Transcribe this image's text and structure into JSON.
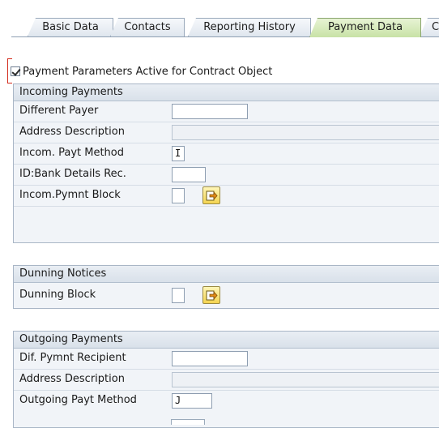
{
  "tabs": [
    {
      "label": "Basic Data",
      "active": false
    },
    {
      "label": "Contacts",
      "active": false
    },
    {
      "label": "Reporting History",
      "active": false
    },
    {
      "label": "Payment Data",
      "active": true
    },
    {
      "label": "C",
      "active": false
    }
  ],
  "checkbox": {
    "label": "Payment Parameters Active for Contract Object",
    "checked": true
  },
  "incoming": {
    "title": "Incoming Payments",
    "fields": [
      {
        "label": "Different Payer",
        "value": ""
      },
      {
        "label": "Address Description",
        "value": ""
      },
      {
        "label": "Incom. Payt Method",
        "value": "I"
      },
      {
        "label": "ID:Bank Details Rec.",
        "value": ""
      },
      {
        "label": "Incom.Pymnt Block",
        "value": ""
      }
    ]
  },
  "dunning": {
    "title": "Dunning Notices",
    "fields": [
      {
        "label": "Dunning Block",
        "value": ""
      }
    ]
  },
  "outgoing": {
    "title": "Outgoing Payments",
    "fields": [
      {
        "label": "Dif. Pymnt Recipient",
        "value": ""
      },
      {
        "label": "Address Description",
        "value": ""
      },
      {
        "label": "Outgoing Payt Method",
        "value": "J"
      }
    ]
  },
  "icons": {
    "nav_button": "arrow-into-list-icon"
  },
  "colors": {
    "active_tab": "#c8e2a6",
    "nav_button": "#f4d450",
    "focus_mark": "#d32b1c"
  }
}
